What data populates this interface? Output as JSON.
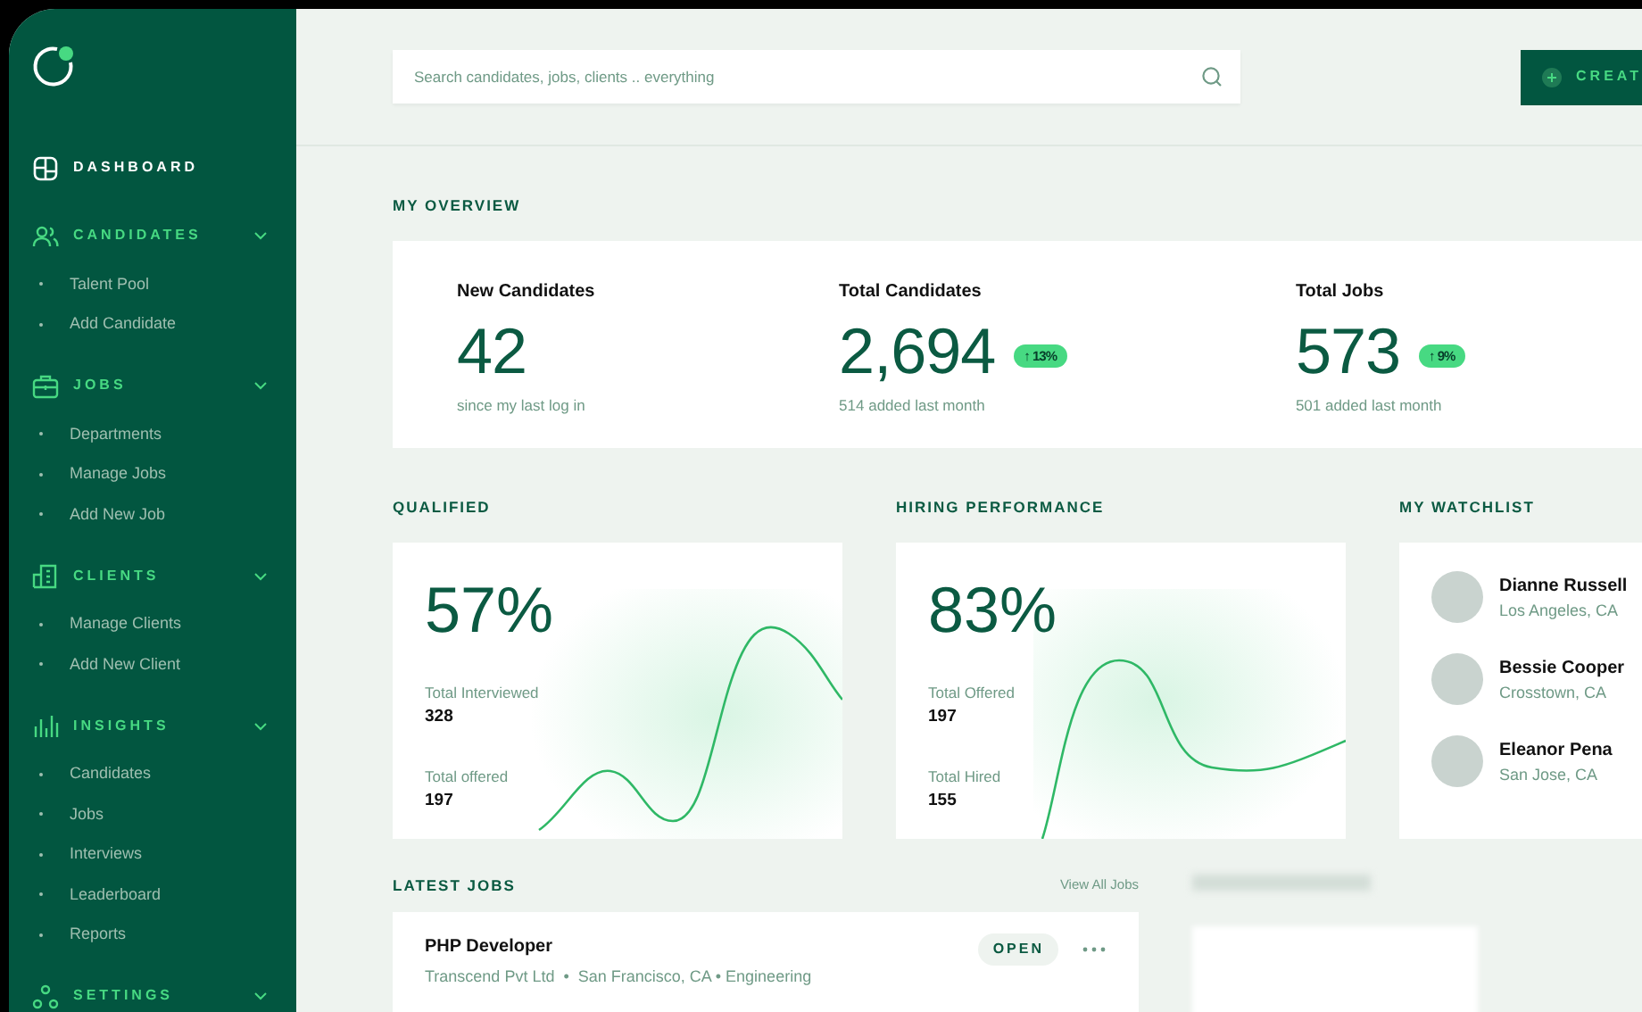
{
  "sidebar": {
    "items": [
      {
        "kind": "link",
        "label": "DASHBOARD"
      },
      {
        "kind": "group",
        "label": "CANDIDATES",
        "children": [
          "Talent Pool",
          "Add Candidate"
        ]
      },
      {
        "kind": "group",
        "label": "JOBS",
        "children": [
          "Departments",
          "Manage Jobs",
          "Add New Job"
        ]
      },
      {
        "kind": "group",
        "label": "CLIENTS",
        "children": [
          "Manage Clients",
          "Add New Client"
        ]
      },
      {
        "kind": "group",
        "label": "INSIGHTS",
        "children": [
          "Candidates",
          "Jobs",
          "Interviews",
          "Leaderboard",
          "Reports"
        ]
      },
      {
        "kind": "group",
        "label": "SETTINGS"
      }
    ]
  },
  "search": {
    "placeholder": "Search candidates, jobs, clients .. everything"
  },
  "create_button": {
    "label": "CREAT"
  },
  "overview": {
    "title": "MY OVERVIEW",
    "stats": [
      {
        "label": "New Candidates",
        "value": "42",
        "note": "since my last log in"
      },
      {
        "label": "Total Candidates",
        "value": "2,694",
        "change": "↑ 13%",
        "note": "514 added last month"
      },
      {
        "label": "Total Jobs",
        "value": "573",
        "change": "↑ 9%",
        "note": "501 added last month"
      }
    ]
  },
  "qualified": {
    "title": "QUALIFIED",
    "percent": "57%",
    "metrics": [
      {
        "label": "Total Interviewed",
        "value": "328"
      },
      {
        "label": "Total offered",
        "value": "197"
      }
    ]
  },
  "hiring": {
    "title": "HIRING PERFORMANCE",
    "percent": "83%",
    "metrics": [
      {
        "label": "Total Offered",
        "value": "197"
      },
      {
        "label": "Total Hired",
        "value": "155"
      }
    ]
  },
  "watchlist": {
    "title": "MY WATCHLIST",
    "people": [
      {
        "name": "Dianne Russell",
        "location": "Los Angeles, CA"
      },
      {
        "name": "Bessie Cooper",
        "location": "Crosstown, CA"
      },
      {
        "name": "Eleanor Pena",
        "location": "San Jose, CA"
      }
    ]
  },
  "latest_jobs": {
    "title": "LATEST JOBS",
    "link": "View All Jobs",
    "jobs": [
      {
        "title": "PHP Developer",
        "details": "Transcend Pvt Ltd  •  San Francisco, CA • Engineering",
        "status": "OPEN"
      }
    ]
  }
}
